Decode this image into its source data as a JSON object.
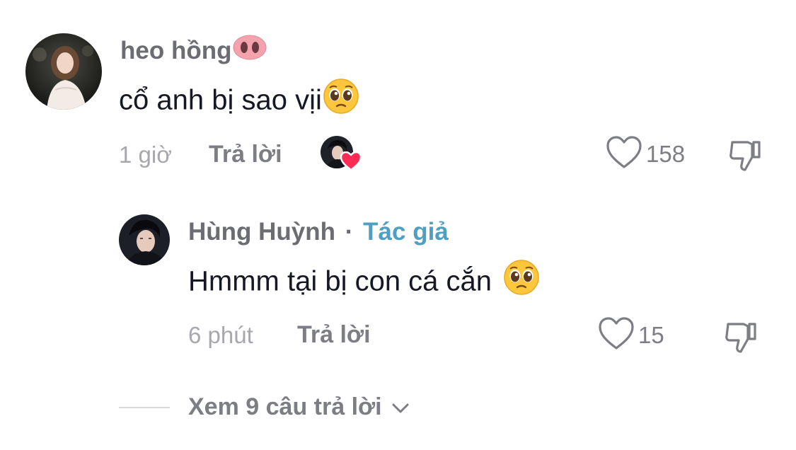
{
  "comment": {
    "username": "heo hồng",
    "username_emoji": "pig-nose-emoji",
    "text": "cổ anh bị sao vịi",
    "text_emoji": "pleading-face-emoji",
    "time": "1 giờ",
    "reply_label": "Trả lời",
    "like_count": "158",
    "creator_liked": true
  },
  "reply": {
    "username": "Hùng Huỳnh",
    "separator": "·",
    "author_label": "Tác giả",
    "text": "Hmmm tại bị con cá cắn",
    "text_emoji": "pleading-face-emoji",
    "time": "6 phút",
    "reply_label": "Trả lời",
    "like_count": "15"
  },
  "view_more": {
    "label": "Xem 9 câu trả lời"
  },
  "colors": {
    "author_badge": "#4f9fc0",
    "liked_heart": "#fe2c55",
    "secondary_text": "#7c7e84"
  }
}
